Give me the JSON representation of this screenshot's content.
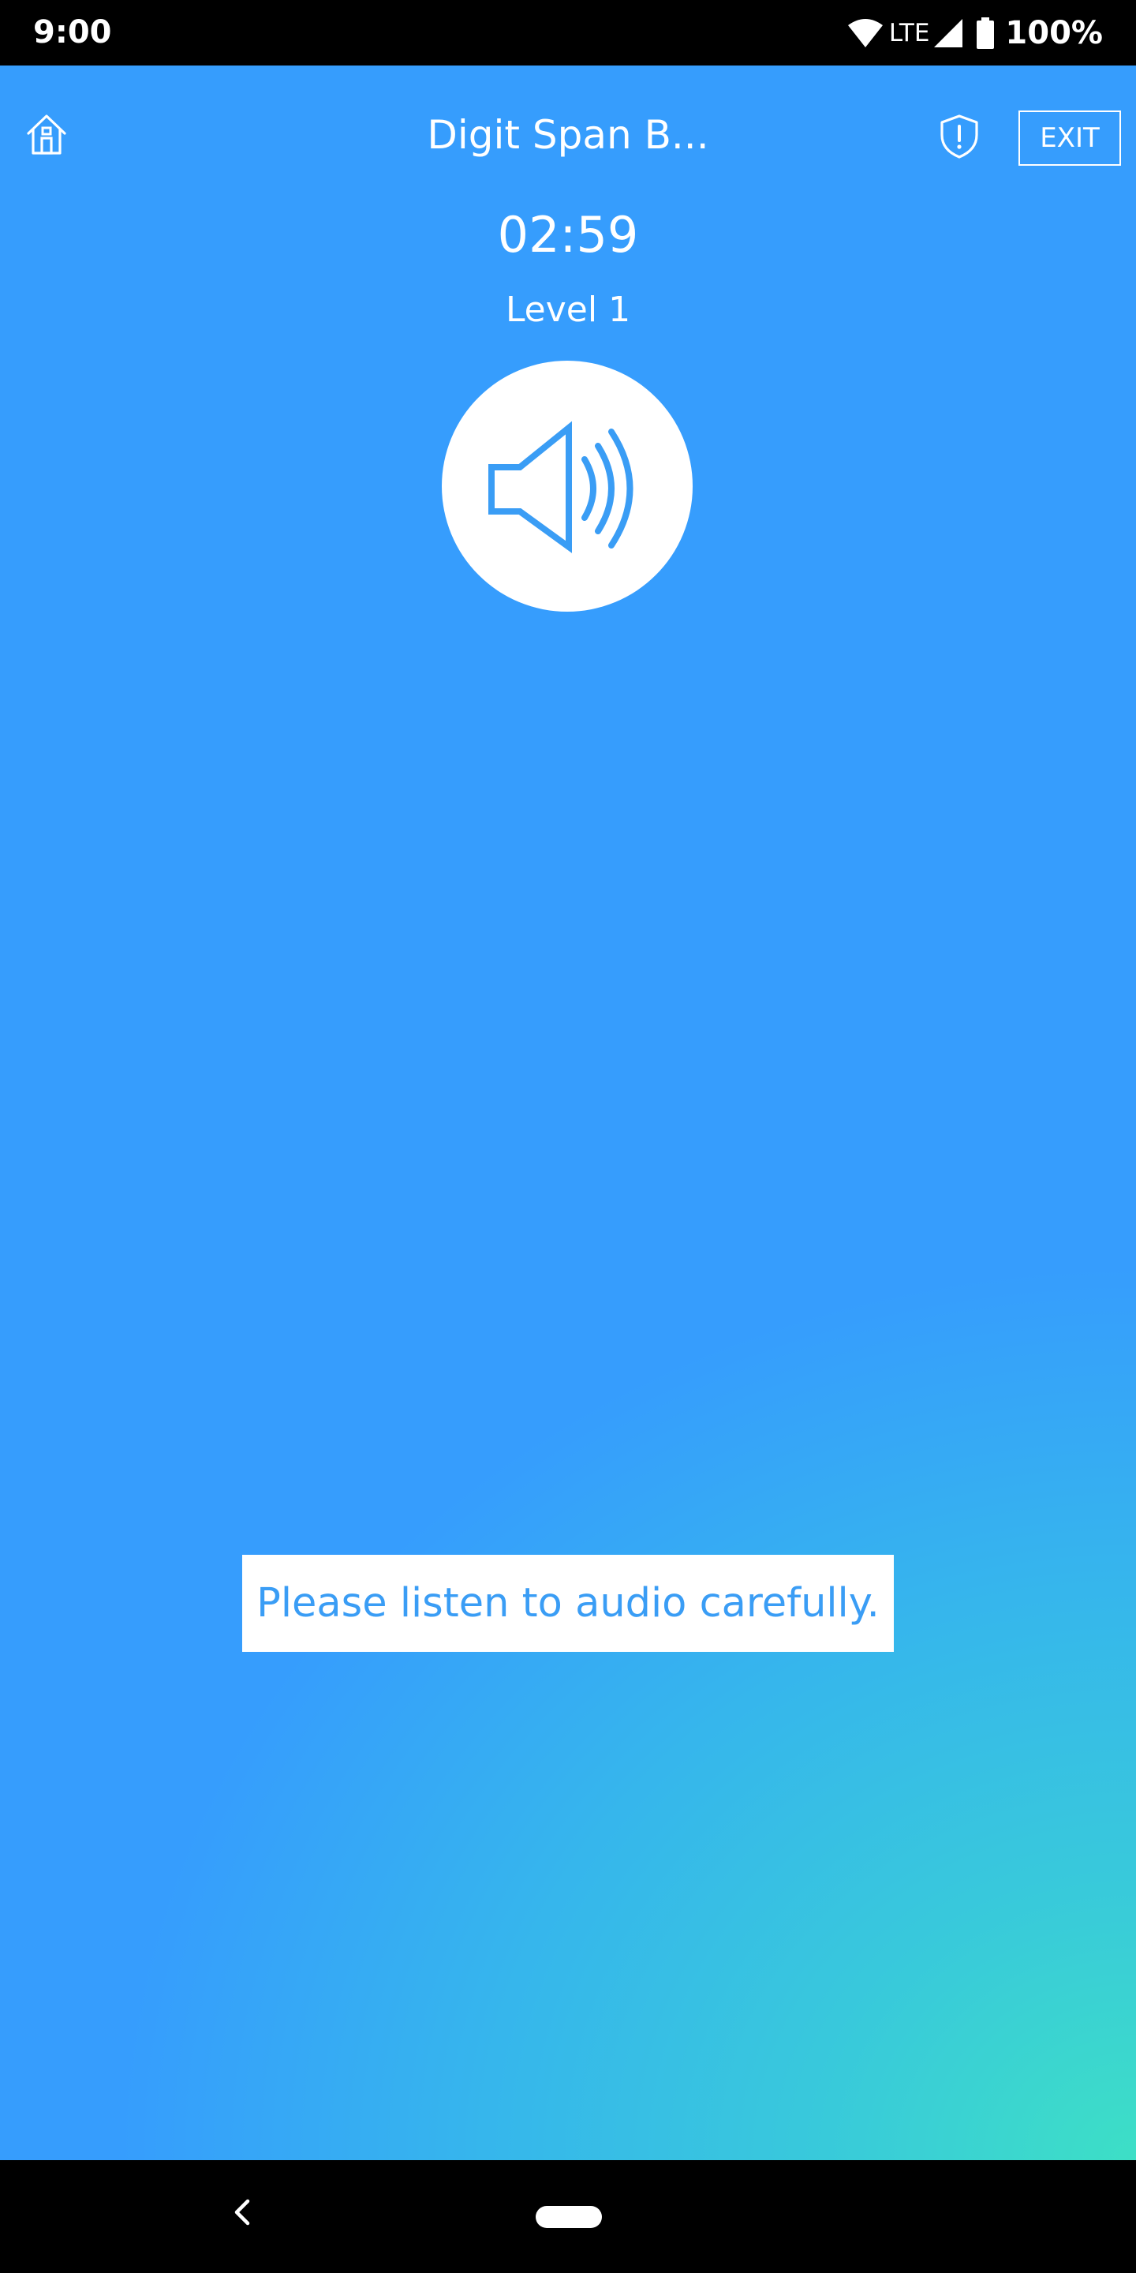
{
  "status_bar": {
    "time": "9:00",
    "network": "LTE",
    "battery": "100%",
    "icons": [
      "wifi-icon",
      "signal-icon",
      "battery-icon"
    ]
  },
  "header": {
    "title": "Digit Span B...",
    "exit_label": "EXIT",
    "icons": [
      "home-icon",
      "shield-alert-icon"
    ]
  },
  "game": {
    "timer": "02:59",
    "level": "Level 1",
    "speaker_icon": "speaker-volume-icon",
    "instruction": "Please listen to audio carefully."
  },
  "nav_bar": {
    "icons": [
      "back-icon",
      "home-pill-icon"
    ]
  },
  "colors": {
    "background_top": "#369dfd",
    "background_bottom_right": "#3ddfc6",
    "accent": "#3a9df5",
    "text": "#ffffff"
  }
}
